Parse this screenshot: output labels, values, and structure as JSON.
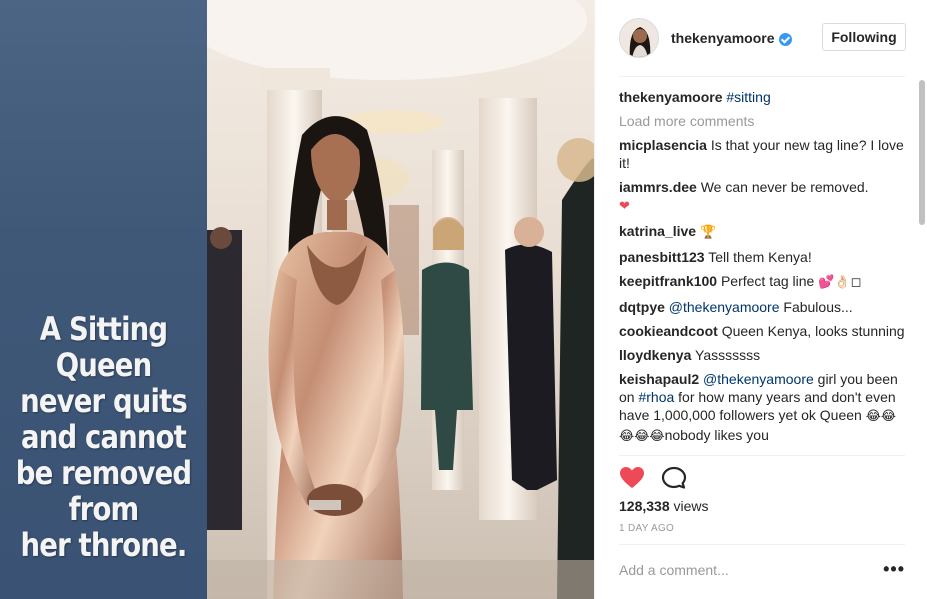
{
  "media": {
    "quote": "A Sitting\nQueen\nnever quits\nand cannot\nbe removed\nfrom\nher throne."
  },
  "header": {
    "username": "thekenyamoore",
    "follow_label": "Following"
  },
  "caption": {
    "user": "thekenyamoore",
    "hashtag": "#sitting"
  },
  "load_more_label": "Load more comments",
  "comments": [
    {
      "user": "micplasencia",
      "text": "Is that your new tag line? I love it!"
    },
    {
      "user": "iammrs.dee",
      "text": "We can never be removed.",
      "emoji": "❤"
    },
    {
      "user": "katrina_live",
      "text": "",
      "emoji": "🏆"
    },
    {
      "user": "panesbitt123",
      "text": "Tell them Kenya!"
    },
    {
      "user": "keepitfrank100",
      "text": "Perfect tag line",
      "emoji": "💕👌🏻◻"
    },
    {
      "user": "dqtpye",
      "mention": "@thekenyamoore",
      "text": "Fabulous..."
    },
    {
      "user": "cookieandcoot",
      "text": "Queen Kenya, looks stunning"
    },
    {
      "user": "lloydkenya",
      "text": "Yasssssss"
    },
    {
      "user": "keishapaul2",
      "mention": "@thekenyamoore",
      "text_a": "girl you been on",
      "hashtag": "#rhoa",
      "text_b": "for how many years and don't even have 1,000,000 followers yet ok Queen",
      "emoji": "😂😂😂😂😂",
      "text_c": "nobody likes you"
    }
  ],
  "stats": {
    "views_count": "128,338",
    "views_label": "views",
    "timestamp": "1 DAY AGO"
  },
  "add_comment": {
    "placeholder": "Add a comment..."
  },
  "more_label": "•••",
  "colors": {
    "link": "#003569",
    "muted": "#999999",
    "heart": "#ed4956",
    "verified": "#3897f0",
    "quote_panel": "#3f5878"
  },
  "icons": [
    "verified-badge-icon",
    "heart-icon",
    "comment-icon",
    "more-options-icon"
  ]
}
